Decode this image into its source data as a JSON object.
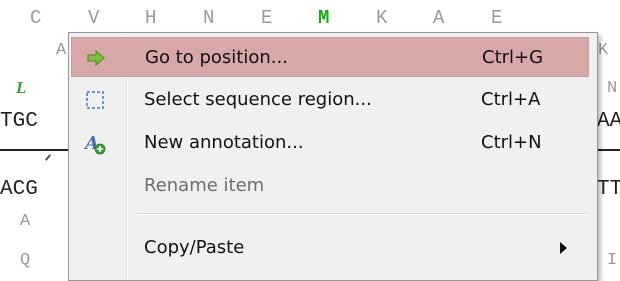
{
  "sequence_view": {
    "amino_top": [
      "C",
      "V",
      "H",
      "N",
      "E",
      "M",
      "K",
      "A",
      "E"
    ],
    "highlight_color": "#14a814",
    "left_strand_top": "TGC",
    "left_strand_bottom": "ACG",
    "right_strand_top": "AA",
    "right_strand_bottom": "TT",
    "left_marks": [
      "A",
      "L",
      "A",
      "Q"
    ],
    "right_marks": [
      "K",
      "N",
      "I"
    ]
  },
  "context_menu": {
    "items": [
      {
        "label": "Go to position...",
        "shortcut": "Ctrl+G",
        "icon": "green-arrow-icon",
        "state": "hovered"
      },
      {
        "label": "Select sequence region...",
        "shortcut": "Ctrl+A",
        "icon": "dashed-selection-icon",
        "state": "enabled"
      },
      {
        "label": "New annotation...",
        "shortcut": "Ctrl+N",
        "icon": "annotation-add-icon",
        "state": "enabled"
      },
      {
        "label": "Rename item",
        "shortcut": "",
        "icon": "",
        "state": "disabled"
      },
      {
        "label": "Copy/Paste",
        "shortcut": "",
        "icon": "",
        "state": "submenu"
      }
    ]
  }
}
